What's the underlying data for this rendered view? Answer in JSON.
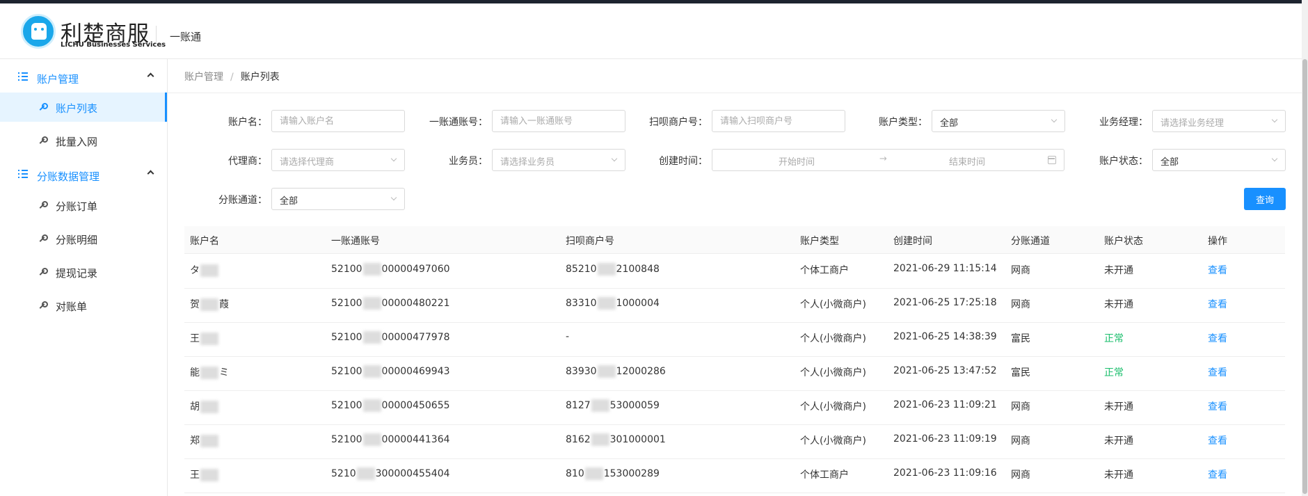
{
  "header": {
    "brand_cn": "利楚商服",
    "brand_en": "LICHU Businesses Services",
    "app_name": "一账通"
  },
  "sidebar": {
    "groups": [
      {
        "label": "账户管理",
        "items": [
          {
            "label": "账户列表",
            "active": true
          },
          {
            "label": "批量入网"
          }
        ]
      },
      {
        "label": "分账数据管理",
        "items": [
          {
            "label": "分账订单"
          },
          {
            "label": "分账明细"
          },
          {
            "label": "提现记录"
          },
          {
            "label": "对账单"
          }
        ]
      }
    ]
  },
  "breadcrumb": {
    "parent": "账户管理",
    "separator": "/",
    "current": "账户列表"
  },
  "filters": {
    "account_name": {
      "label": "账户名：",
      "placeholder": "请输入账户名"
    },
    "yzt_no": {
      "label": "一账通账号：",
      "placeholder": "请输入一账通账号"
    },
    "merchant_no": {
      "label": "扫呗商户号：",
      "placeholder": "请输入扫呗商户号"
    },
    "account_type": {
      "label": "账户类型：",
      "value": "全部"
    },
    "manager": {
      "label": "业务经理：",
      "placeholder": "请选择业务经理"
    },
    "agent": {
      "label": "代理商：",
      "placeholder": "请选择代理商"
    },
    "salesman": {
      "label": "业务员：",
      "placeholder": "请选择业务员"
    },
    "created": {
      "label": "创建时间：",
      "start_placeholder": "开始时间",
      "separator": "→",
      "end_placeholder": "结束时间"
    },
    "status": {
      "label": "账户状态：",
      "value": "全部"
    },
    "channel": {
      "label": "分账通道：",
      "value": "全部"
    },
    "query_button": "查询"
  },
  "table": {
    "columns": [
      "账户名",
      "一账通账号",
      "扫呗商户号",
      "账户类型",
      "创建时间",
      "分账通道",
      "账户状态",
      "操作"
    ],
    "rows": [
      {
        "name_a": "タ",
        "name_b": "",
        "yzt_a": "52100",
        "yzt_b": "00000497060",
        "merchant_a": "85210",
        "merchant_b": "2100848",
        "type": "个体工商户",
        "created": "2021-06-29 11:15:14",
        "channel": "网商",
        "status": "未开通",
        "action": "查看"
      },
      {
        "name_a": "贺",
        "name_b": "葭",
        "yzt_a": "52100",
        "yzt_b": "00000480221",
        "merchant_a": "83310",
        "merchant_b": "1000004",
        "type": "个人(小微商户)",
        "created": "2021-06-25 17:25:18",
        "channel": "网商",
        "status": "未开通",
        "action": "查看"
      },
      {
        "name_a": "王",
        "name_b": "",
        "yzt_a": "52100",
        "yzt_b": "00000477978",
        "merchant_a": "-",
        "merchant_b": "",
        "type": "个人(小微商户)",
        "created": "2021-06-25 14:38:39",
        "channel": "富民",
        "status": "正常",
        "action": "查看"
      },
      {
        "name_a": "能",
        "name_b": "ミ",
        "yzt_a": "52100",
        "yzt_b": "00000469943",
        "merchant_a": "83930",
        "merchant_b": "12000286",
        "type": "个人(小微商户)",
        "created": "2021-06-25 13:47:52",
        "channel": "富民",
        "status": "正常",
        "action": "查看"
      },
      {
        "name_a": "胡",
        "name_b": "",
        "yzt_a": "52100",
        "yzt_b": "00000450655",
        "merchant_a": "8127",
        "merchant_b": "53000059",
        "type": "个人(小微商户)",
        "created": "2021-06-23 11:09:21",
        "channel": "网商",
        "status": "未开通",
        "action": "查看"
      },
      {
        "name_a": "郑",
        "name_b": "",
        "yzt_a": "52100",
        "yzt_b": "00000441364",
        "merchant_a": "8162",
        "merchant_b": "301000001",
        "type": "个人(小微商户)",
        "created": "2021-06-23 11:09:19",
        "channel": "网商",
        "status": "未开通",
        "action": "查看"
      },
      {
        "name_a": "王",
        "name_b": "",
        "yzt_a": "5210",
        "yzt_b": "300000455404",
        "merchant_a": "810",
        "merchant_b": "153000289",
        "type": "个体工商户",
        "created": "2021-06-23 11:09:16",
        "channel": "网商",
        "status": "未开通",
        "action": "查看"
      }
    ]
  },
  "colors": {
    "accent": "#1890ff",
    "ok": "#19be6b",
    "topbar": "#1d2430"
  }
}
